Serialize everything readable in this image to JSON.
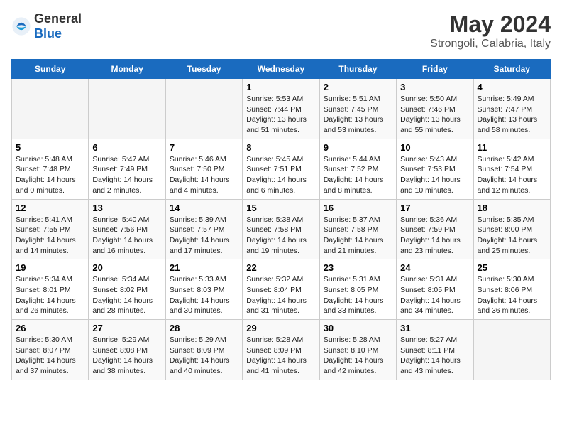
{
  "header": {
    "logo_general": "General",
    "logo_blue": "Blue",
    "month_year": "May 2024",
    "location": "Strongoli, Calabria, Italy"
  },
  "days_of_week": [
    "Sunday",
    "Monday",
    "Tuesday",
    "Wednesday",
    "Thursday",
    "Friday",
    "Saturday"
  ],
  "weeks": [
    [
      {
        "day": "",
        "info": ""
      },
      {
        "day": "",
        "info": ""
      },
      {
        "day": "",
        "info": ""
      },
      {
        "day": "1",
        "info": "Sunrise: 5:53 AM\nSunset: 7:44 PM\nDaylight: 13 hours\nand 51 minutes."
      },
      {
        "day": "2",
        "info": "Sunrise: 5:51 AM\nSunset: 7:45 PM\nDaylight: 13 hours\nand 53 minutes."
      },
      {
        "day": "3",
        "info": "Sunrise: 5:50 AM\nSunset: 7:46 PM\nDaylight: 13 hours\nand 55 minutes."
      },
      {
        "day": "4",
        "info": "Sunrise: 5:49 AM\nSunset: 7:47 PM\nDaylight: 13 hours\nand 58 minutes."
      }
    ],
    [
      {
        "day": "5",
        "info": "Sunrise: 5:48 AM\nSunset: 7:48 PM\nDaylight: 14 hours\nand 0 minutes."
      },
      {
        "day": "6",
        "info": "Sunrise: 5:47 AM\nSunset: 7:49 PM\nDaylight: 14 hours\nand 2 minutes."
      },
      {
        "day": "7",
        "info": "Sunrise: 5:46 AM\nSunset: 7:50 PM\nDaylight: 14 hours\nand 4 minutes."
      },
      {
        "day": "8",
        "info": "Sunrise: 5:45 AM\nSunset: 7:51 PM\nDaylight: 14 hours\nand 6 minutes."
      },
      {
        "day": "9",
        "info": "Sunrise: 5:44 AM\nSunset: 7:52 PM\nDaylight: 14 hours\nand 8 minutes."
      },
      {
        "day": "10",
        "info": "Sunrise: 5:43 AM\nSunset: 7:53 PM\nDaylight: 14 hours\nand 10 minutes."
      },
      {
        "day": "11",
        "info": "Sunrise: 5:42 AM\nSunset: 7:54 PM\nDaylight: 14 hours\nand 12 minutes."
      }
    ],
    [
      {
        "day": "12",
        "info": "Sunrise: 5:41 AM\nSunset: 7:55 PM\nDaylight: 14 hours\nand 14 minutes."
      },
      {
        "day": "13",
        "info": "Sunrise: 5:40 AM\nSunset: 7:56 PM\nDaylight: 14 hours\nand 16 minutes."
      },
      {
        "day": "14",
        "info": "Sunrise: 5:39 AM\nSunset: 7:57 PM\nDaylight: 14 hours\nand 17 minutes."
      },
      {
        "day": "15",
        "info": "Sunrise: 5:38 AM\nSunset: 7:58 PM\nDaylight: 14 hours\nand 19 minutes."
      },
      {
        "day": "16",
        "info": "Sunrise: 5:37 AM\nSunset: 7:58 PM\nDaylight: 14 hours\nand 21 minutes."
      },
      {
        "day": "17",
        "info": "Sunrise: 5:36 AM\nSunset: 7:59 PM\nDaylight: 14 hours\nand 23 minutes."
      },
      {
        "day": "18",
        "info": "Sunrise: 5:35 AM\nSunset: 8:00 PM\nDaylight: 14 hours\nand 25 minutes."
      }
    ],
    [
      {
        "day": "19",
        "info": "Sunrise: 5:34 AM\nSunset: 8:01 PM\nDaylight: 14 hours\nand 26 minutes."
      },
      {
        "day": "20",
        "info": "Sunrise: 5:34 AM\nSunset: 8:02 PM\nDaylight: 14 hours\nand 28 minutes."
      },
      {
        "day": "21",
        "info": "Sunrise: 5:33 AM\nSunset: 8:03 PM\nDaylight: 14 hours\nand 30 minutes."
      },
      {
        "day": "22",
        "info": "Sunrise: 5:32 AM\nSunset: 8:04 PM\nDaylight: 14 hours\nand 31 minutes."
      },
      {
        "day": "23",
        "info": "Sunrise: 5:31 AM\nSunset: 8:05 PM\nDaylight: 14 hours\nand 33 minutes."
      },
      {
        "day": "24",
        "info": "Sunrise: 5:31 AM\nSunset: 8:05 PM\nDaylight: 14 hours\nand 34 minutes."
      },
      {
        "day": "25",
        "info": "Sunrise: 5:30 AM\nSunset: 8:06 PM\nDaylight: 14 hours\nand 36 minutes."
      }
    ],
    [
      {
        "day": "26",
        "info": "Sunrise: 5:30 AM\nSunset: 8:07 PM\nDaylight: 14 hours\nand 37 minutes."
      },
      {
        "day": "27",
        "info": "Sunrise: 5:29 AM\nSunset: 8:08 PM\nDaylight: 14 hours\nand 38 minutes."
      },
      {
        "day": "28",
        "info": "Sunrise: 5:29 AM\nSunset: 8:09 PM\nDaylight: 14 hours\nand 40 minutes."
      },
      {
        "day": "29",
        "info": "Sunrise: 5:28 AM\nSunset: 8:09 PM\nDaylight: 14 hours\nand 41 minutes."
      },
      {
        "day": "30",
        "info": "Sunrise: 5:28 AM\nSunset: 8:10 PM\nDaylight: 14 hours\nand 42 minutes."
      },
      {
        "day": "31",
        "info": "Sunrise: 5:27 AM\nSunset: 8:11 PM\nDaylight: 14 hours\nand 43 minutes."
      },
      {
        "day": "",
        "info": ""
      }
    ]
  ]
}
